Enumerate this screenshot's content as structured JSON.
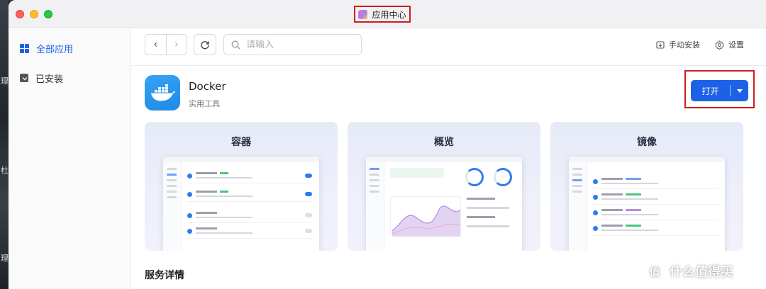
{
  "window": {
    "title": "应用中心"
  },
  "desktop_strip": {
    "glyphs": [
      "理",
      "杜",
      "理"
    ]
  },
  "sidebar": {
    "items": [
      {
        "label": "全部应用",
        "active": true
      },
      {
        "label": "已安装",
        "active": false
      }
    ]
  },
  "toolbar": {
    "back_glyph": "‹",
    "forward_glyph": "›",
    "search_placeholder": "请输入",
    "manual_install_label": "手动安装",
    "settings_label": "设置"
  },
  "app": {
    "name": "Docker",
    "category": "实用工具",
    "open_label": "打开"
  },
  "previews": [
    {
      "title": "容器"
    },
    {
      "title": "概览"
    },
    {
      "title": "镜像"
    }
  ],
  "details": {
    "section_title": "服务详情"
  },
  "watermark": {
    "text": "什么值得买",
    "logo_glyph": "值"
  },
  "colors": {
    "accent": "#1d62e6",
    "highlight_box": "#d11b1b"
  }
}
